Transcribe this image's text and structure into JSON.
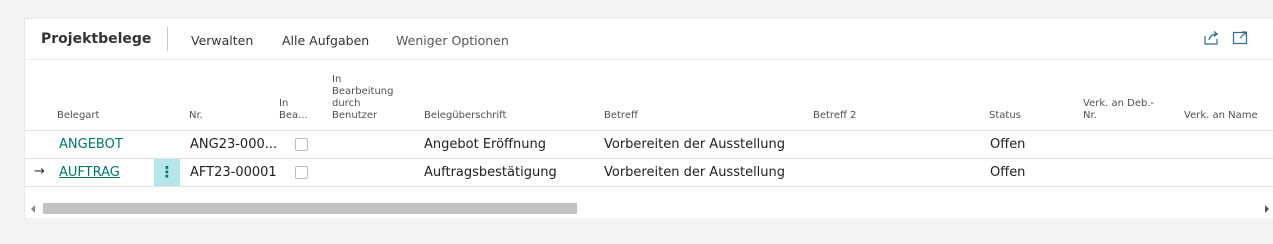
{
  "actionbar": {
    "title": "Projektbelege",
    "actions": [
      "Verwalten",
      "Alle Aufgaben",
      "Weniger Optionen"
    ],
    "icons": [
      "share-icon",
      "expand-icon"
    ]
  },
  "table": {
    "columns": {
      "belegart": "Belegart",
      "nr": "Nr.",
      "in_bea_1": "In",
      "in_bea_2": "Bea...",
      "in_bearb_1": "In",
      "in_bearb_2": "Bearbeitung",
      "in_bearb_3": "durch",
      "in_bearb_4": "Benutzer",
      "belegueberschrift": "Belegüberschrift",
      "betreff": "Betreff",
      "betreff2": "Betreff 2",
      "status": "Status",
      "verk_deb_1": "Verk. an Deb.-",
      "verk_deb_2": "Nr.",
      "verk_name": "Verk. an Name"
    },
    "rows": [
      {
        "belegart": "ANGEBOT",
        "nr": "ANG23-000...",
        "belegueberschrift": "Angebot Eröffnung",
        "betreff": "Vorbereiten der Ausstellung",
        "betreff2": "",
        "status": "Offen"
      },
      {
        "selected_indicator": "→",
        "context_menu": "⋮",
        "belegart": "AUFTRAG",
        "nr": "AFT23-00001",
        "belegueberschrift": "Auftragsbestätigung",
        "betreff": "Vorbereiten der Ausstellung",
        "betreff2": "",
        "status": "Offen"
      }
    ]
  },
  "colors": {
    "link": "#00776b",
    "selected_cell": "#b5e6ea"
  }
}
